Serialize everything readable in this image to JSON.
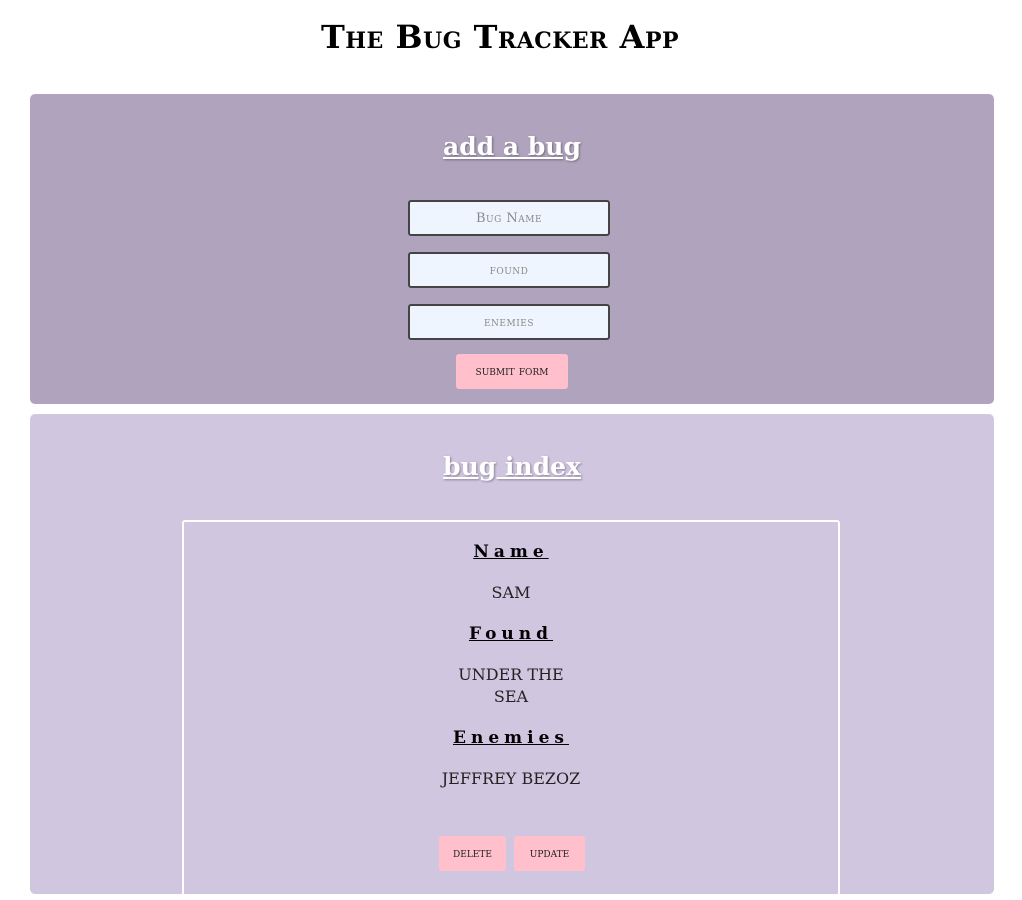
{
  "app": {
    "title": "The Bug Tracker App"
  },
  "add_form": {
    "heading": "add a bug",
    "name_placeholder": "Bug Name",
    "found_placeholder": "found",
    "enemies_placeholder": "enemies",
    "submit_label": "submit form"
  },
  "bug_index": {
    "heading": "bug index",
    "bugs": [
      {
        "name_label": "Name",
        "name": "Sam",
        "found_label": "Found",
        "found": "under the sea",
        "enemies_label": "Enemies",
        "enemies": "jeffrey bezoz",
        "delete_label": "delete",
        "update_label": "update"
      }
    ]
  },
  "colors": {
    "add_panel_bg": "#b0a3bd",
    "index_panel_bg": "#d1c6e0",
    "button_bg": "#ffc0cb",
    "input_bg": "#eef5ff"
  }
}
